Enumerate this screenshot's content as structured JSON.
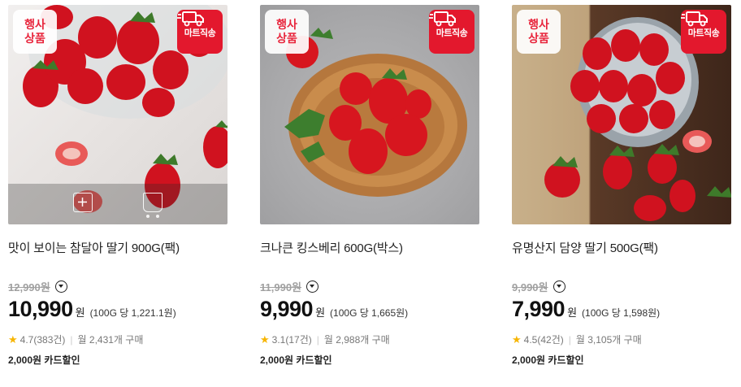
{
  "products": [
    {
      "event_badge": [
        "행사",
        "상품"
      ],
      "delivery_badge": "마트직송",
      "title": "맛이 보이는 참달아 딸기 900G(팩)",
      "original_price": "12,990",
      "original_unit": "원",
      "price": "10,990",
      "price_unit": "원",
      "unit_price": "(100G 당 1,221.1원)",
      "rating": "4.7",
      "review_count": "(383건)",
      "monthly_purchases": "월 2,431개 구매",
      "card_discount": "2,000원 카드할인"
    },
    {
      "event_badge": [
        "행사",
        "상품"
      ],
      "delivery_badge": "마트직송",
      "title": "크나큰 킹스베리 600G(박스)",
      "original_price": "11,990",
      "original_unit": "원",
      "price": "9,990",
      "price_unit": "원",
      "unit_price": "(100G 당 1,665원)",
      "rating": "3.1",
      "review_count": "(17건)",
      "monthly_purchases": "월 2,988개 구매",
      "card_discount": "2,000원 카드할인"
    },
    {
      "event_badge": [
        "행사",
        "상품"
      ],
      "delivery_badge": "마트직송",
      "title": "유명산지 담양 딸기 500G(팩)",
      "original_price": "9,990",
      "original_unit": "원",
      "price": "7,990",
      "price_unit": "원",
      "unit_price": "(100G 당 1,598원)",
      "rating": "4.5",
      "review_count": "(42건)",
      "monthly_purchases": "월 3,105개 구매",
      "card_discount": "2,000원 카드할인"
    }
  ],
  "icons": {
    "star": "star-icon",
    "dropdown": "chevron-down-circle-icon",
    "delivery": "truck-icon",
    "compare": "add-compare-icon",
    "cart": "cart-icon"
  },
  "colors": {
    "accent_red": "#e3182d",
    "star_yellow": "#f7b500"
  }
}
